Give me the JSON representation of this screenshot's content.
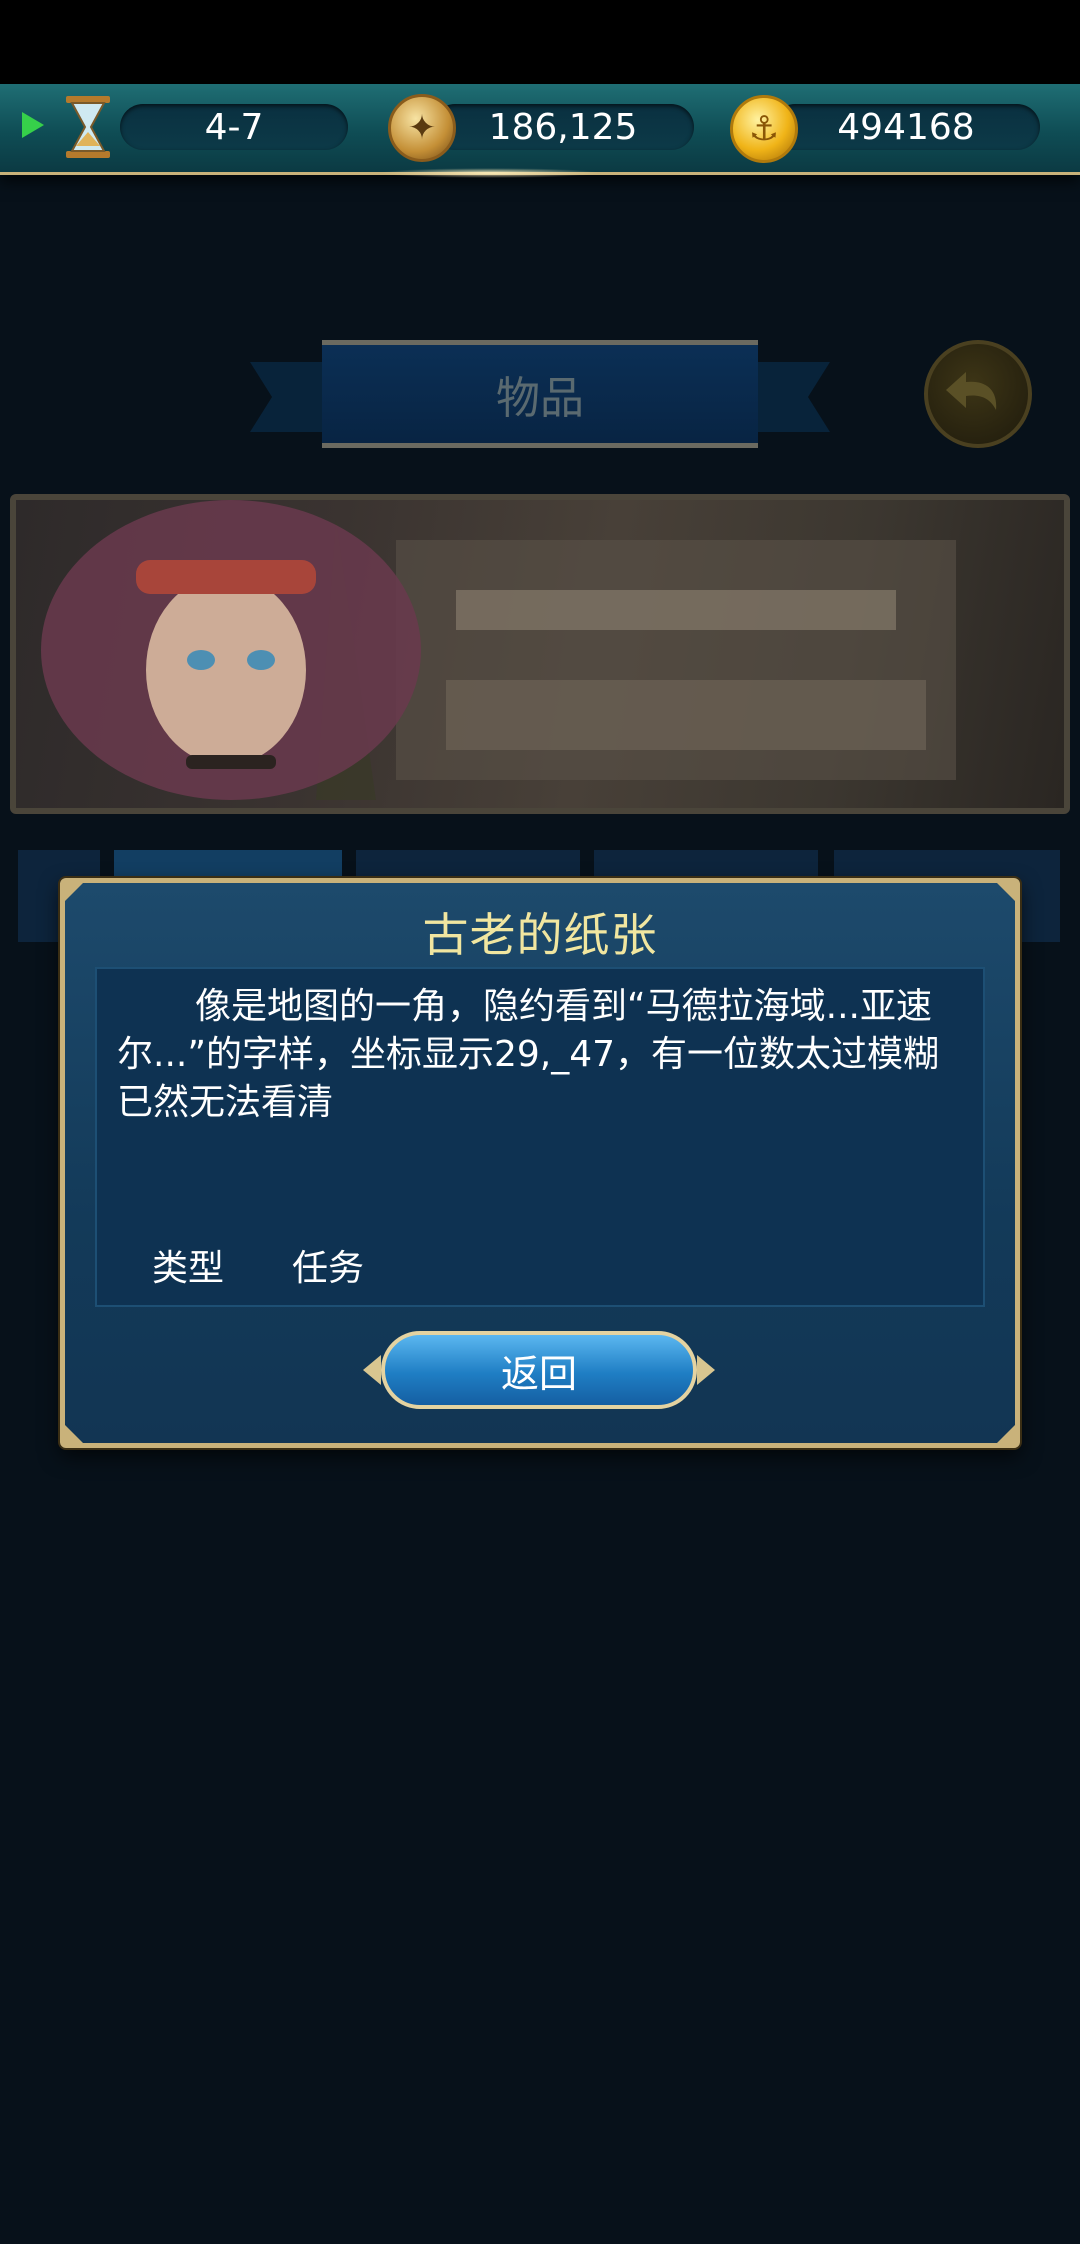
{
  "resource_bar": {
    "progress": "4-7",
    "compass_value": "186,125",
    "gold_value": "494168"
  },
  "screen": {
    "title": "物品"
  },
  "dialog": {
    "title": "古老的纸张",
    "description": "像是地图的一角，隐约看到“马德拉海域...亚速尔...”的字样，坐标显示29,_47，有一位数太过模糊已然无法看清",
    "type_label": "类型",
    "type_value": "任务",
    "return_label": "返回"
  }
}
